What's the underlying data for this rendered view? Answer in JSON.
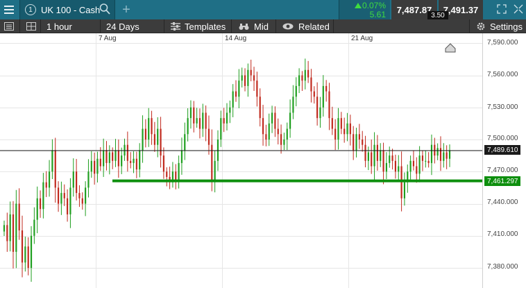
{
  "header": {
    "tab_number": "1",
    "instrument": "UK 100 - Cash",
    "change_pct": "0.07%",
    "change_pts": "5.61",
    "sell_price": "7,487.87",
    "buy_price": "7,491.37",
    "spread": "3.50"
  },
  "toolbar": {
    "interval": "1 hour",
    "range": "24 Days",
    "templates_label": "Templates",
    "price_type": "Mid",
    "related_label": "Related",
    "settings_label": "Settings"
  },
  "icons": [
    "menu-icon",
    "search-icon",
    "plus-icon",
    "up-arrow-icon",
    "expand-icon",
    "collapse-icon",
    "list-icon",
    "layout-icon",
    "templates-icon",
    "binoculars-icon",
    "eye-icon",
    "gear-icon",
    "scroll-up-icon"
  ],
  "colors": {
    "up_candle": "#1e9e1e",
    "down_candle": "#c0281c",
    "support_line": "#0e8f0e",
    "header_bg": "#1f6f86",
    "change_positive": "#3fdc3f"
  },
  "chart_data": {
    "type": "candlestick",
    "x_ticks": [
      "7 Aug",
      "14 Aug",
      "21 Aug"
    ],
    "y_ticks": [
      "7,380.000",
      "7,410.000",
      "7,440.000",
      "7,470.000",
      "7,500.000",
      "7,530.000",
      "7,560.000",
      "7,590.000"
    ],
    "ylim": [
      7375,
      7590
    ],
    "current_price_line": 7489.61,
    "current_price_label": "7,489.610",
    "support_line": 7461.297,
    "support_label": "7,461.297",
    "grid": true,
    "closes": [
      7420,
      7405,
      7430,
      7395,
      7440,
      7415,
      7385,
      7400,
      7380,
      7410,
      7425,
      7445,
      7435,
      7460,
      7455,
      7470,
      7490,
      7455,
      7440,
      7450,
      7445,
      7430,
      7455,
      7470,
      7450,
      7445,
      7440,
      7455,
      7470,
      7480,
      7468,
      7482,
      7475,
      7490,
      7478,
      7488,
      7480,
      7490,
      7475,
      7485,
      7495,
      7480,
      7478,
      7482,
      7472,
      7490,
      7510,
      7500,
      7520,
      7505,
      7495,
      7510,
      7485,
      7470,
      7465,
      7460,
      7470,
      7462,
      7478,
      7490,
      7505,
      7520,
      7530,
      7515,
      7520,
      7510,
      7525,
      7510,
      7495,
      7462,
      7480,
      7500,
      7520,
      7515,
      7525,
      7530,
      7545,
      7540,
      7555,
      7560,
      7550,
      7565,
      7560,
      7555,
      7540,
      7520,
      7505,
      7500,
      7515,
      7525,
      7510,
      7505,
      7495,
      7500,
      7510,
      7525,
      7540,
      7550,
      7560,
      7555,
      7565,
      7558,
      7545,
      7540,
      7520,
      7530,
      7550,
      7545,
      7520,
      7510,
      7500,
      7520,
      7510,
      7505,
      7515,
      7505,
      7490,
      7505,
      7500,
      7495,
      7480,
      7488,
      7475,
      7495,
      7480,
      7490,
      7470,
      7478,
      7485,
      7480,
      7470,
      7475,
      7445,
      7460,
      7470,
      7480,
      7475,
      7468,
      7485,
      7480,
      7480,
      7478,
      7495,
      7485,
      7492,
      7480,
      7488,
      7482,
      7490
    ]
  }
}
